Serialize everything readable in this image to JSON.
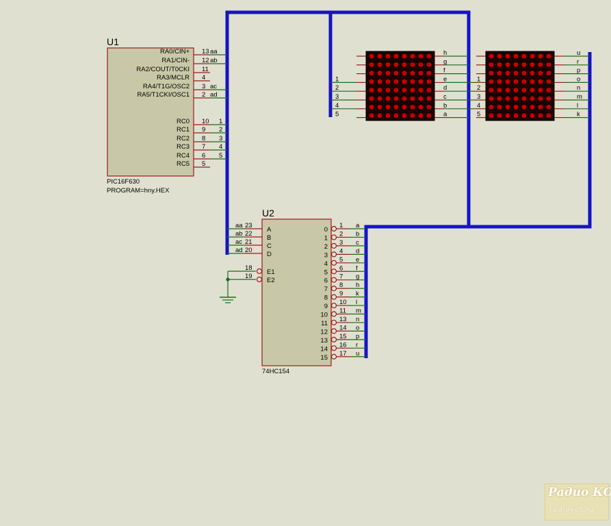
{
  "u1": {
    "ref": "U1",
    "part": "PIC16F630",
    "program": "PROGRAM=hny.HEX",
    "pins": [
      {
        "name": "RA0/CIN+",
        "num": "13",
        "net": "aa"
      },
      {
        "name": "RA1/CIN-",
        "num": "12",
        "net": "ab"
      },
      {
        "name": "RA2/COUT/T0CKI",
        "num": "11",
        "net": ""
      },
      {
        "name": "RA3/MCLR",
        "num": "4",
        "net": ""
      },
      {
        "name": "RA4/T1G/OSC2",
        "num": "3",
        "net": "ac"
      },
      {
        "name": "RA5/T1CKI/OSC1",
        "num": "2",
        "net": "ad"
      },
      {
        "name": "RC0",
        "num": "10",
        "net": "1"
      },
      {
        "name": "RC1",
        "num": "9",
        "net": "2"
      },
      {
        "name": "RC2",
        "num": "8",
        "net": "3"
      },
      {
        "name": "RC3",
        "num": "7",
        "net": "4"
      },
      {
        "name": "RC4",
        "num": "6",
        "net": "5"
      },
      {
        "name": "RC5",
        "num": "5",
        "net": ""
      }
    ]
  },
  "u2": {
    "ref": "U2",
    "part": "74HC154",
    "inputs": [
      {
        "name": "A",
        "num": "23",
        "net": "aa"
      },
      {
        "name": "B",
        "num": "22",
        "net": "ab"
      },
      {
        "name": "C",
        "num": "21",
        "net": "ac"
      },
      {
        "name": "D",
        "num": "20",
        "net": "ad"
      },
      {
        "name": "E1",
        "num": "18",
        "net": ""
      },
      {
        "name": "E2",
        "num": "19",
        "net": ""
      }
    ],
    "outputs": [
      {
        "name": "0",
        "num": "1",
        "net": "a"
      },
      {
        "name": "1",
        "num": "2",
        "net": "b"
      },
      {
        "name": "2",
        "num": "3",
        "net": "c"
      },
      {
        "name": "3",
        "num": "4",
        "net": "d"
      },
      {
        "name": "4",
        "num": "5",
        "net": "e"
      },
      {
        "name": "5",
        "num": "6",
        "net": "f"
      },
      {
        "name": "6",
        "num": "7",
        "net": "g"
      },
      {
        "name": "7",
        "num": "8",
        "net": "h"
      },
      {
        "name": "8",
        "num": "9",
        "net": "k"
      },
      {
        "name": "9",
        "num": "10",
        "net": "l"
      },
      {
        "name": "10",
        "num": "11",
        "net": "m"
      },
      {
        "name": "11",
        "num": "13",
        "net": "n"
      },
      {
        "name": "12",
        "num": "14",
        "net": "o"
      },
      {
        "name": "13",
        "num": "15",
        "net": "p"
      },
      {
        "name": "14",
        "num": "16",
        "net": "r"
      },
      {
        "name": "15",
        "num": "17",
        "net": "u"
      }
    ]
  },
  "matrix1": {
    "left_nets": [
      "1",
      "2",
      "3",
      "4",
      "5"
    ],
    "right_nets": [
      "h",
      "g",
      "f",
      "e",
      "d",
      "c",
      "b",
      "a"
    ]
  },
  "matrix2": {
    "left_nets": [
      "1",
      "2",
      "3",
      "4",
      "5"
    ],
    "right_nets": [
      "u",
      "r",
      "p",
      "o",
      "n",
      "m",
      "l",
      "k"
    ]
  },
  "colors": {
    "background": "#e0e0d0",
    "component_fill": "#c8c8a8",
    "component_border": "#9b1b1b",
    "pin": "#9b1b1b",
    "wire": "#1a6b1a",
    "bus": "#1414c8",
    "led_on": "#cc0000",
    "matrix_body": "#1a0000"
  },
  "watermark": {
    "logo": "Радио КОТ",
    "site": "radiokot.ru"
  }
}
